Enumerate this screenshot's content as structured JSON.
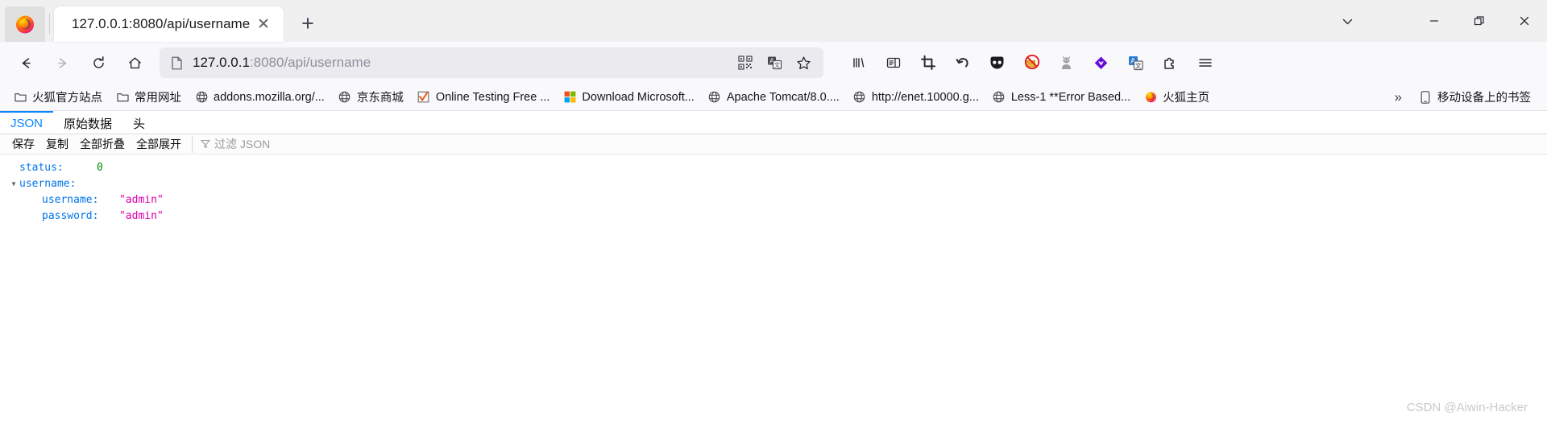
{
  "window": {
    "controls": [
      {
        "name": "list-all-tabs",
        "glyph": "⌄"
      },
      {
        "name": "minimize",
        "glyph": "—"
      },
      {
        "name": "restore",
        "glyph": "❐"
      },
      {
        "name": "close",
        "glyph": "✕"
      }
    ]
  },
  "tabstrip": {
    "tab_title": "127.0.0.1:8080/api/username",
    "close_glyph": "✕",
    "new_tab_glyph": "+",
    "new_tab_name": "new-tab-button"
  },
  "nav": {
    "back": "←",
    "forward": "→",
    "reload": "↻",
    "home": "⌂"
  },
  "urlbar": {
    "host": "127.0.0.1",
    "rest": ":8080/api/username",
    "full": "127.0.0.1:8080/api/username",
    "actions": [
      "qr-code-icon",
      "translate-icon",
      "bookmark-star-icon"
    ]
  },
  "toolbar_right": {
    "items": [
      {
        "name": "library-icon"
      },
      {
        "name": "sidebar-icon"
      },
      {
        "name": "screenshot-crop-icon"
      },
      {
        "name": "undo-arrow-icon"
      },
      {
        "name": "pocket-icon"
      },
      {
        "name": "adblock-icon"
      },
      {
        "name": "privacy-badger-icon"
      },
      {
        "name": "violentmonkey-icon"
      },
      {
        "name": "translate-extension-icon"
      },
      {
        "name": "extensions-puzzle-icon"
      },
      {
        "name": "app-menu-icon"
      }
    ]
  },
  "bookmarks": {
    "items": [
      {
        "label": "火狐官方站点",
        "icon": "folder-icon"
      },
      {
        "label": "常用网址",
        "icon": "folder-icon"
      },
      {
        "label": "addons.mozilla.org/...",
        "icon": "globe-icon"
      },
      {
        "label": "京东商城",
        "icon": "globe-icon"
      },
      {
        "label": "Online Testing Free ...",
        "icon": "checkmark-icon"
      },
      {
        "label": "Download Microsoft...",
        "icon": "microsoft-icon"
      },
      {
        "label": "Apache Tomcat/8.0....",
        "icon": "globe-icon"
      },
      {
        "label": "http://enet.10000.g...",
        "icon": "globe-icon"
      },
      {
        "label": "Less-1 **Error Based...",
        "icon": "globe-icon"
      },
      {
        "label": "火狐主页",
        "icon": "firefox-icon"
      }
    ],
    "overflow_glyph": "»",
    "mobile_label": "移动设备上的书签",
    "mobile_icon": "mobile-device-icon"
  },
  "json_viewer": {
    "tabs": [
      {
        "label": "JSON",
        "active": true
      },
      {
        "label": "原始数据",
        "active": false
      },
      {
        "label": "头",
        "active": false
      }
    ],
    "actions": [
      "保存",
      "复制",
      "全部折叠",
      "全部展开"
    ],
    "filter_placeholder": "过滤 JSON",
    "rows": [
      {
        "indent": 1,
        "twisty": "",
        "key": "status:",
        "value": "0",
        "type": "num"
      },
      {
        "indent": 0,
        "twisty": "▼",
        "key": "username:",
        "value": "",
        "type": ""
      },
      {
        "indent": 2,
        "twisty": "",
        "key": "username:",
        "value": "\"admin\"",
        "type": "str"
      },
      {
        "indent": 2,
        "twisty": "",
        "key": "password:",
        "value": "\"admin\"",
        "type": "str"
      }
    ]
  },
  "watermark": {
    "text": "CSDN @Aiwin-Hacker"
  },
  "colors": {
    "accent": "#0a84ff",
    "json_key": "#0074e8",
    "json_string": "#dd00a9",
    "json_number": "#058b00",
    "chrome_bg": "#f9f9fb",
    "tabstrip_bg": "#f0f0f0"
  }
}
